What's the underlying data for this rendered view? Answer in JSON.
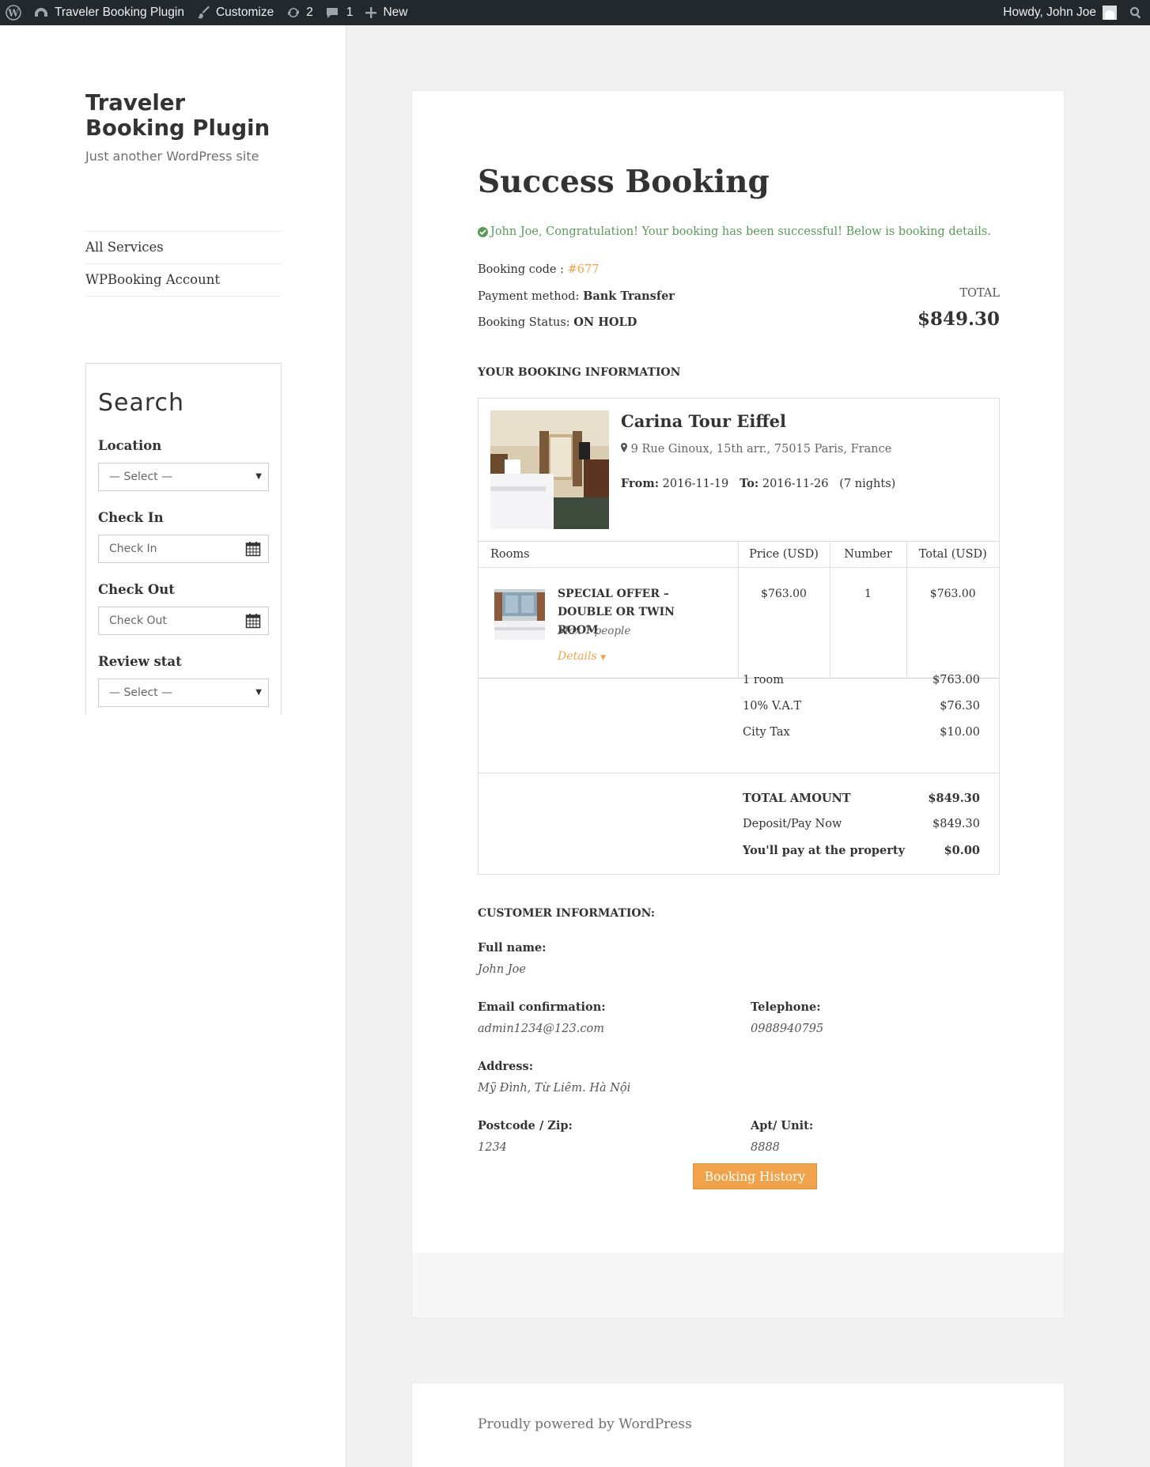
{
  "admin_bar": {
    "site_name": "Traveler Booking Plugin",
    "customize": "Customize",
    "updates_count": "2",
    "comments_count": "1",
    "new_label": "New",
    "howdy": "Howdy, John Joe"
  },
  "sidebar": {
    "site_title": "Traveler Booking Plugin",
    "site_description": "Just another WordPress site",
    "menu": [
      {
        "label": "All Services"
      },
      {
        "label": "WPBooking Account"
      }
    ],
    "search": {
      "title": "Search",
      "location_label": "Location",
      "location_value": "— Select —",
      "checkin_label": "Check In",
      "checkin_placeholder": "Check In",
      "checkout_label": "Check Out",
      "checkout_placeholder": "Check Out",
      "review_label": "Review stat",
      "review_value": "— Select —"
    }
  },
  "booking": {
    "title": "Success Booking",
    "success_message": "John Joe, Congratulation! Your booking has been successful! Below is booking details.",
    "code_label": "Booking code :",
    "code_value": "#677",
    "payment_label": "Payment method:",
    "payment_value": "Bank Transfer",
    "status_label": "Booking Status:",
    "status_value": "ON HOLD",
    "total_label": "TOTAL",
    "total_value": "$849.30",
    "section_title": "YOUR BOOKING INFORMATION",
    "hotel": {
      "name": "Carina Tour Eiffel",
      "address": "9 Rue Ginoux, 15th arr., 75015 Paris, France",
      "from_label": "From:",
      "from_date": "2016-11-19",
      "to_label": "To:",
      "to_date": "2016-11-26",
      "nights": "(7 nights)"
    },
    "table": {
      "headers": [
        "Rooms",
        "Price (USD)",
        "Number",
        "Total (USD)"
      ],
      "room": {
        "name": "SPECIAL OFFER – DOUBLE OR TWIN ROOM",
        "max": "Max 7 people",
        "details": "Details",
        "price": "$763.00",
        "number": "1",
        "total": "$763.00"
      }
    },
    "summary": {
      "rooms_label": "1 room",
      "rooms_value": "$763.00",
      "vat_label": "10% V.A.T",
      "vat_value": "$76.30",
      "tax_label": "City Tax",
      "tax_value": "$10.00",
      "total_amount_label": "TOTAL AMOUNT",
      "total_amount_value": "$849.30",
      "deposit_label": "Deposit/Pay Now",
      "deposit_value": "$849.30",
      "property_label": "You'll pay at the property",
      "property_value": "$0.00"
    }
  },
  "customer": {
    "section_title": "CUSTOMER INFORMATION:",
    "fullname_label": "Full name:",
    "fullname_value": "John Joe",
    "email_label": "Email confirmation:",
    "email_value": "admin1234@123.com",
    "phone_label": "Telephone:",
    "phone_value": "0988940795",
    "address_label": "Address:",
    "address_value": "Mỹ Đình, Từ Liêm. Hà Nội",
    "postcode_label": "Postcode / Zip:",
    "postcode_value": "1234",
    "apt_label": "Apt/ Unit:",
    "apt_value": "8888"
  },
  "history_button": "Booking History",
  "footer": "Proudly powered by WordPress",
  "colors": {
    "accent": "#f0a34b",
    "success": "#5a9a5a",
    "admin_bar": "#23282d"
  }
}
